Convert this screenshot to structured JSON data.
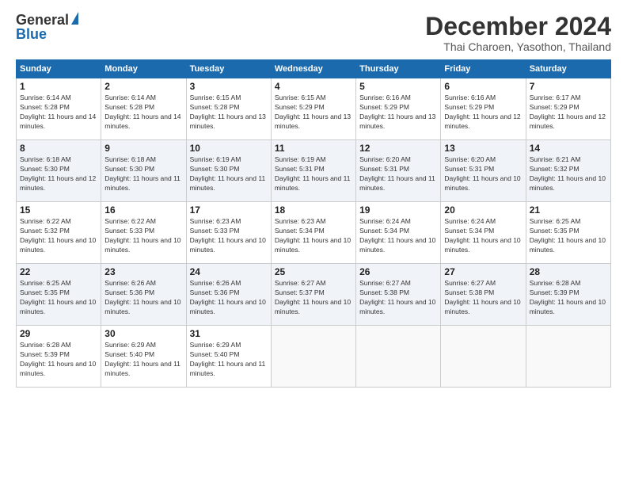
{
  "logo": {
    "general": "General",
    "blue": "Blue"
  },
  "title": "December 2024",
  "location": "Thai Charoen, Yasothon, Thailand",
  "days_of_week": [
    "Sunday",
    "Monday",
    "Tuesday",
    "Wednesday",
    "Thursday",
    "Friday",
    "Saturday"
  ],
  "weeks": [
    [
      {
        "day": "1",
        "sunrise": "6:14 AM",
        "sunset": "5:28 PM",
        "daylight": "11 hours and 14 minutes."
      },
      {
        "day": "2",
        "sunrise": "6:14 AM",
        "sunset": "5:28 PM",
        "daylight": "11 hours and 14 minutes."
      },
      {
        "day": "3",
        "sunrise": "6:15 AM",
        "sunset": "5:28 PM",
        "daylight": "11 hours and 13 minutes."
      },
      {
        "day": "4",
        "sunrise": "6:15 AM",
        "sunset": "5:29 PM",
        "daylight": "11 hours and 13 minutes."
      },
      {
        "day": "5",
        "sunrise": "6:16 AM",
        "sunset": "5:29 PM",
        "daylight": "11 hours and 13 minutes."
      },
      {
        "day": "6",
        "sunrise": "6:16 AM",
        "sunset": "5:29 PM",
        "daylight": "11 hours and 12 minutes."
      },
      {
        "day": "7",
        "sunrise": "6:17 AM",
        "sunset": "5:29 PM",
        "daylight": "11 hours and 12 minutes."
      }
    ],
    [
      {
        "day": "8",
        "sunrise": "6:18 AM",
        "sunset": "5:30 PM",
        "daylight": "11 hours and 12 minutes."
      },
      {
        "day": "9",
        "sunrise": "6:18 AM",
        "sunset": "5:30 PM",
        "daylight": "11 hours and 11 minutes."
      },
      {
        "day": "10",
        "sunrise": "6:19 AM",
        "sunset": "5:30 PM",
        "daylight": "11 hours and 11 minutes."
      },
      {
        "day": "11",
        "sunrise": "6:19 AM",
        "sunset": "5:31 PM",
        "daylight": "11 hours and 11 minutes."
      },
      {
        "day": "12",
        "sunrise": "6:20 AM",
        "sunset": "5:31 PM",
        "daylight": "11 hours and 11 minutes."
      },
      {
        "day": "13",
        "sunrise": "6:20 AM",
        "sunset": "5:31 PM",
        "daylight": "11 hours and 10 minutes."
      },
      {
        "day": "14",
        "sunrise": "6:21 AM",
        "sunset": "5:32 PM",
        "daylight": "11 hours and 10 minutes."
      }
    ],
    [
      {
        "day": "15",
        "sunrise": "6:22 AM",
        "sunset": "5:32 PM",
        "daylight": "11 hours and 10 minutes."
      },
      {
        "day": "16",
        "sunrise": "6:22 AM",
        "sunset": "5:33 PM",
        "daylight": "11 hours and 10 minutes."
      },
      {
        "day": "17",
        "sunrise": "6:23 AM",
        "sunset": "5:33 PM",
        "daylight": "11 hours and 10 minutes."
      },
      {
        "day": "18",
        "sunrise": "6:23 AM",
        "sunset": "5:34 PM",
        "daylight": "11 hours and 10 minutes."
      },
      {
        "day": "19",
        "sunrise": "6:24 AM",
        "sunset": "5:34 PM",
        "daylight": "11 hours and 10 minutes."
      },
      {
        "day": "20",
        "sunrise": "6:24 AM",
        "sunset": "5:34 PM",
        "daylight": "11 hours and 10 minutes."
      },
      {
        "day": "21",
        "sunrise": "6:25 AM",
        "sunset": "5:35 PM",
        "daylight": "11 hours and 10 minutes."
      }
    ],
    [
      {
        "day": "22",
        "sunrise": "6:25 AM",
        "sunset": "5:35 PM",
        "daylight": "11 hours and 10 minutes."
      },
      {
        "day": "23",
        "sunrise": "6:26 AM",
        "sunset": "5:36 PM",
        "daylight": "11 hours and 10 minutes."
      },
      {
        "day": "24",
        "sunrise": "6:26 AM",
        "sunset": "5:36 PM",
        "daylight": "11 hours and 10 minutes."
      },
      {
        "day": "25",
        "sunrise": "6:27 AM",
        "sunset": "5:37 PM",
        "daylight": "11 hours and 10 minutes."
      },
      {
        "day": "26",
        "sunrise": "6:27 AM",
        "sunset": "5:38 PM",
        "daylight": "11 hours and 10 minutes."
      },
      {
        "day": "27",
        "sunrise": "6:27 AM",
        "sunset": "5:38 PM",
        "daylight": "11 hours and 10 minutes."
      },
      {
        "day": "28",
        "sunrise": "6:28 AM",
        "sunset": "5:39 PM",
        "daylight": "11 hours and 10 minutes."
      }
    ],
    [
      {
        "day": "29",
        "sunrise": "6:28 AM",
        "sunset": "5:39 PM",
        "daylight": "11 hours and 10 minutes."
      },
      {
        "day": "30",
        "sunrise": "6:29 AM",
        "sunset": "5:40 PM",
        "daylight": "11 hours and 11 minutes."
      },
      {
        "day": "31",
        "sunrise": "6:29 AM",
        "sunset": "5:40 PM",
        "daylight": "11 hours and 11 minutes."
      },
      null,
      null,
      null,
      null
    ]
  ]
}
